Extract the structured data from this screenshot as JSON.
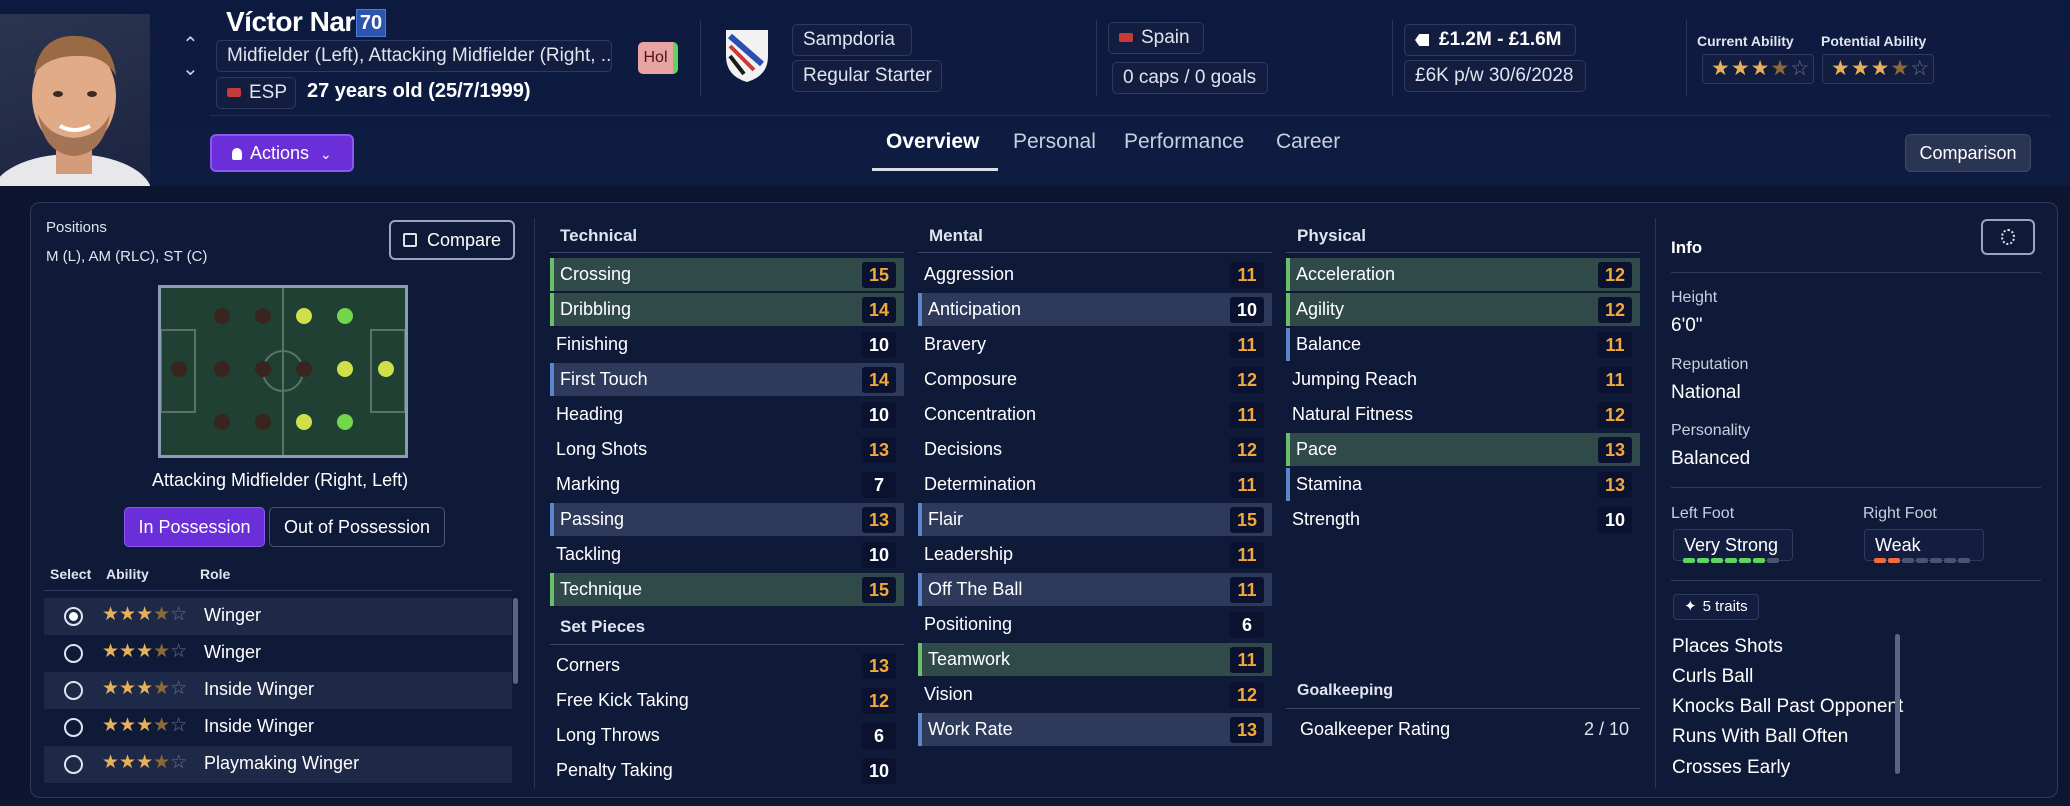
{
  "player": {
    "name": "Víctor Narro",
    "ca_value": "70",
    "positions_long": "Midfielder (Left), Attacking Midfielder (Right, ...",
    "nation_code": "ESP",
    "age": "27 years old (25/7/1999)",
    "hol_badge": "Hol"
  },
  "club": {
    "name": "Sampdoria",
    "status": "Regular Starter"
  },
  "nation": {
    "name": "Spain",
    "caps": "0 caps / 0 goals"
  },
  "contract": {
    "value": "£1.2M - £1.6M",
    "wage": "£6K p/w 30/6/2028"
  },
  "ability": {
    "current_label": "Current Ability",
    "potential_label": "Potential Ability",
    "current_stars": 3.5,
    "potential_stars": 3.5
  },
  "nav": {
    "actions": "Actions",
    "tabs": [
      "Overview",
      "Personal",
      "Performance",
      "Career"
    ],
    "active_tab": "Overview",
    "comparison": "Comparison"
  },
  "positions": {
    "label": "Positions",
    "value": "M (L), AM (RLC), ST (C)",
    "compare": "Compare",
    "selected_role": "Attacking Midfielder (Right, Left)",
    "in_possession": "In Possession",
    "out_possession": "Out of Possession"
  },
  "roles": {
    "headers": [
      "Select",
      "Ability",
      "Role"
    ],
    "rows": [
      {
        "name": "Winger",
        "selected": true,
        "stars": 3.5
      },
      {
        "name": "Winger",
        "selected": false,
        "stars": 3.5
      },
      {
        "name": "Inside Winger",
        "selected": false,
        "stars": 3.5
      },
      {
        "name": "Inside Winger",
        "selected": false,
        "stars": 3.5
      },
      {
        "name": "Playmaking Winger",
        "selected": false,
        "stars": 3.5
      }
    ]
  },
  "attributes": {
    "technical_title": "Technical",
    "technical": [
      {
        "name": "Crossing",
        "value": "15"
      },
      {
        "name": "Dribbling",
        "value": "14"
      },
      {
        "name": "Finishing",
        "value": "10"
      },
      {
        "name": "First Touch",
        "value": "14"
      },
      {
        "name": "Heading",
        "value": "10"
      },
      {
        "name": "Long Shots",
        "value": "13"
      },
      {
        "name": "Marking",
        "value": "7"
      },
      {
        "name": "Passing",
        "value": "13"
      },
      {
        "name": "Tackling",
        "value": "10"
      },
      {
        "name": "Technique",
        "value": "15"
      }
    ],
    "setpieces_title": "Set Pieces",
    "setpieces": [
      {
        "name": "Corners",
        "value": "13"
      },
      {
        "name": "Free Kick Taking",
        "value": "12"
      },
      {
        "name": "Long Throws",
        "value": "6"
      },
      {
        "name": "Penalty Taking",
        "value": "10"
      }
    ],
    "mental_title": "Mental",
    "mental": [
      {
        "name": "Aggression",
        "value": "11"
      },
      {
        "name": "Anticipation",
        "value": "10"
      },
      {
        "name": "Bravery",
        "value": "11"
      },
      {
        "name": "Composure",
        "value": "12"
      },
      {
        "name": "Concentration",
        "value": "11"
      },
      {
        "name": "Decisions",
        "value": "12"
      },
      {
        "name": "Determination",
        "value": "11"
      },
      {
        "name": "Flair",
        "value": "15"
      },
      {
        "name": "Leadership",
        "value": "11"
      },
      {
        "name": "Off The Ball",
        "value": "11"
      },
      {
        "name": "Positioning",
        "value": "6"
      },
      {
        "name": "Teamwork",
        "value": "11"
      },
      {
        "name": "Vision",
        "value": "12"
      },
      {
        "name": "Work Rate",
        "value": "13"
      }
    ],
    "physical_title": "Physical",
    "physical": [
      {
        "name": "Acceleration",
        "value": "12"
      },
      {
        "name": "Agility",
        "value": "12"
      },
      {
        "name": "Balance",
        "value": "11"
      },
      {
        "name": "Jumping Reach",
        "value": "11"
      },
      {
        "name": "Natural Fitness",
        "value": "12"
      },
      {
        "name": "Pace",
        "value": "13"
      },
      {
        "name": "Stamina",
        "value": "13"
      },
      {
        "name": "Strength",
        "value": "10"
      }
    ],
    "gk_title": "Goalkeeping",
    "gk_label": "Goalkeeper Rating",
    "gk_value": "2 / 10"
  },
  "info": {
    "title": "Info",
    "height_label": "Height",
    "height": "6'0\"",
    "reputation_label": "Reputation",
    "reputation": "National",
    "personality_label": "Personality",
    "personality": "Balanced",
    "left_foot_label": "Left Foot",
    "left_foot": "Very Strong",
    "right_foot_label": "Right Foot",
    "right_foot": "Weak",
    "left_foot_level": 6,
    "right_foot_level": 2,
    "traits_badge": "5 traits",
    "traits": [
      "Places Shots",
      "Curls Ball",
      "Knocks Ball Past Opponent",
      "Runs With Ball Often",
      "Crosses Early"
    ]
  },
  "colors": {
    "accent": "#6a2fd8",
    "highlight_value": "#f2a93b",
    "star": "#e6b15a"
  }
}
